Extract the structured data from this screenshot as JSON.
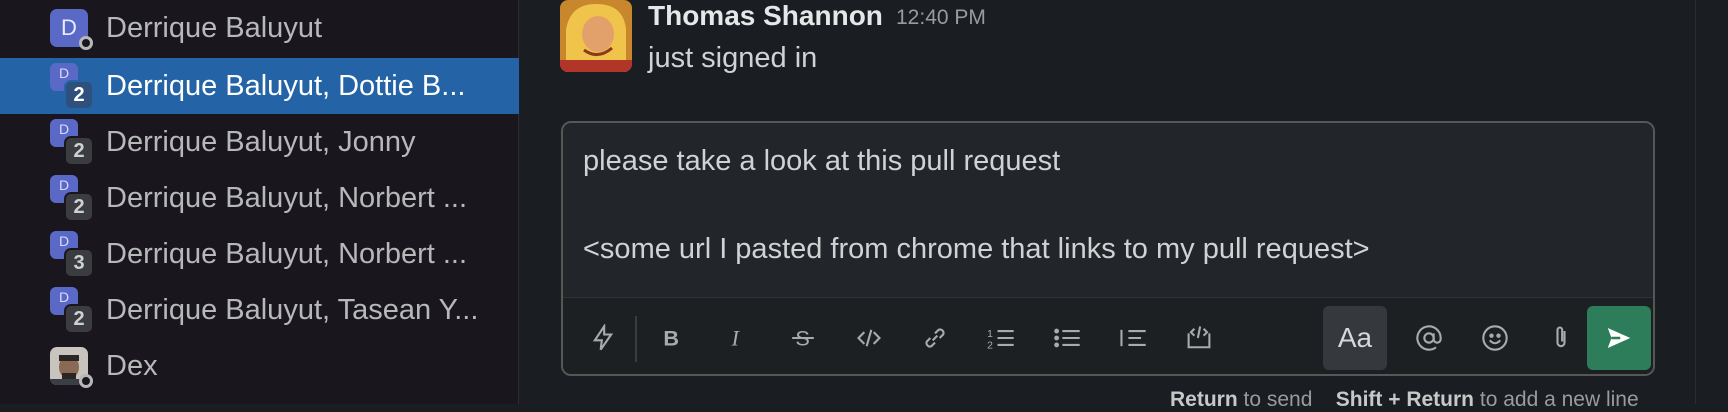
{
  "sidebar": {
    "items": [
      {
        "label": "Derrique Baluyut",
        "avatar_letter": "D",
        "type": "single"
      },
      {
        "label": "Derrique Baluyut, Dottie B...",
        "avatar_letter": "D",
        "count": "2",
        "type": "group",
        "active": true
      },
      {
        "label": "Derrique Baluyut, Jonny",
        "avatar_letter": "D",
        "count": "2",
        "type": "group"
      },
      {
        "label": "Derrique Baluyut, Norbert ...",
        "avatar_letter": "D",
        "count": "2",
        "type": "group"
      },
      {
        "label": "Derrique Baluyut, Norbert ...",
        "avatar_letter": "D",
        "count": "3",
        "type": "group"
      },
      {
        "label": "Derrique Baluyut, Tasean Y...",
        "avatar_letter": "D",
        "count": "2",
        "type": "group"
      },
      {
        "label": "Dex",
        "type": "photo"
      }
    ]
  },
  "message": {
    "author": "Thomas Shannon",
    "time": "12:40 PM",
    "text": "just signed in"
  },
  "composer": {
    "line1": "please take a look at this pull request",
    "line2": "<some url I pasted from chrome that links to my pull request>",
    "format_toggle_label": "Aa"
  },
  "hint": {
    "send_key": "Return",
    "send_text": "to send",
    "newline_key": "Shift + Return",
    "newline_text": "to add a new line"
  },
  "colors": {
    "active_bg": "#2463a6",
    "send_bg": "#2d7d5a",
    "avatar_bg": "#5a69c6"
  },
  "icons": [
    "lightning-icon",
    "bold-icon",
    "italic-icon",
    "strikethrough-icon",
    "code-icon",
    "link-icon",
    "ordered-list-icon",
    "bulleted-list-icon",
    "blockquote-icon",
    "code-block-icon",
    "mention-icon",
    "emoji-icon",
    "attachment-icon",
    "send-icon"
  ]
}
